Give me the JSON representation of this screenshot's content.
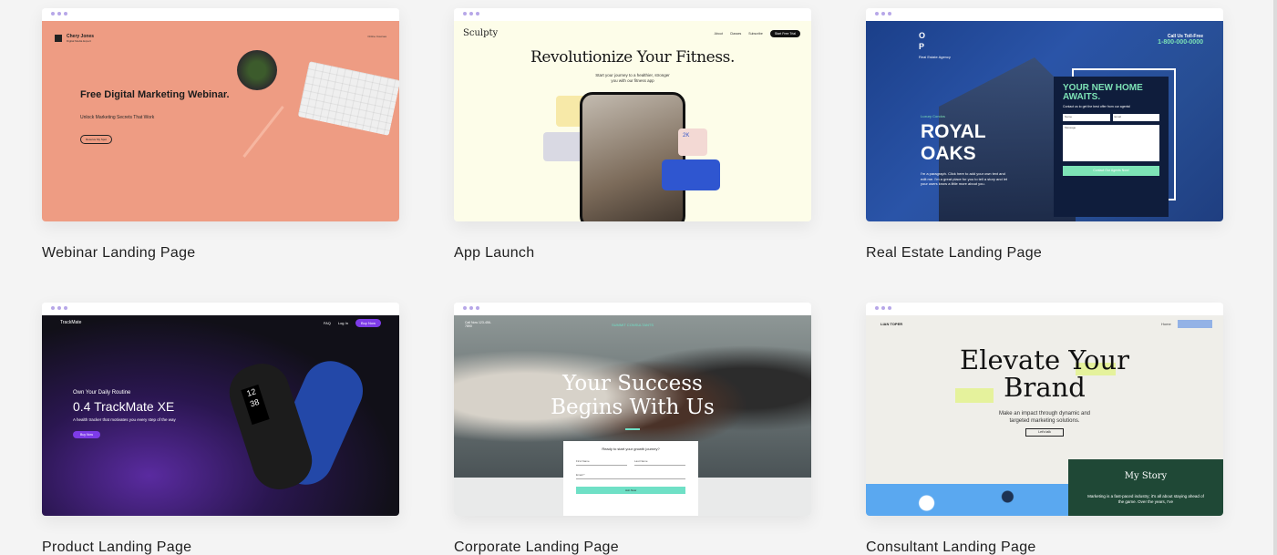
{
  "cards": [
    {
      "caption": "Webinar Landing Page",
      "preview": {
        "brand_name": "Chery Jones",
        "brand_tag": "Digital Media Expert",
        "nav": "Online Courses",
        "title": "Free Digital Marketing Webinar.",
        "subtitle": "Unlock Marketing Secrets That Work",
        "button": "Reserve My Spot"
      }
    },
    {
      "caption": "App Launch",
      "preview": {
        "logo": "Sculpty",
        "nav_1": "About",
        "nav_2": "Classes",
        "nav_3": "Subscribe",
        "nav_button": "Start Free Trial",
        "title": "Revolutionize Your Fitness.",
        "subtitle": "Start your journey to a healthier, stronger you with our fitness app",
        "stat": "2K"
      }
    },
    {
      "caption": "Real Estate Landing Page",
      "preview": {
        "logo": "O P",
        "agency": "Real Estate Agency",
        "call_label": "Call Us Toll-Free",
        "phone": "1-800-000-0000",
        "kicker": "Luxury Condos",
        "title": "ROYAL OAKS",
        "paragraph": "I'm a paragraph. Click here to add your own text and edit me. I'm a great place for you to tell a story and let your users know a little more about you.",
        "form_title": "YOUR NEW HOME AWAITS.",
        "form_text": "Contact us to get the best offer from our agents!",
        "field_name": "Name",
        "field_email": "Email",
        "field_message": "Message",
        "form_button": "Contact Our Agents Now!"
      }
    },
    {
      "caption": "Product Landing Page",
      "preview": {
        "logo": "TrackMate",
        "nav_1": "FAQ",
        "nav_2": "Log In",
        "nav_button": "Buy Now",
        "kicker": "Own Your Daily Routine",
        "title": "0.4 TrackMate XE",
        "subtitle": "A health tracker that motivates you every step of the way",
        "button": "Buy Now",
        "screen_time": "12 38"
      }
    },
    {
      "caption": "Corporate Landing Page",
      "preview": {
        "top_left": "Call Now 123-456-7890",
        "logo": "SUMMIT CONSULTANTS",
        "title": "Your Success Begins With Us",
        "form_prompt": "Ready to start your growth journey?",
        "field_first": "First Name",
        "field_last": "Last Name",
        "field_email": "Email *",
        "form_button": "Join Now"
      }
    },
    {
      "caption": "Consultant Landing Page",
      "preview": {
        "logo": "LIAN TOPER",
        "nav": "Home",
        "title": "Elevate Your Brand",
        "subtitle": "Make an impact through dynamic and targeted marketing solutions.",
        "button": "Let's talk",
        "story_title": "My Story",
        "story_text": "Marketing is a fast-paced industry; it's all about staying ahead of the game. Over the years, I've"
      }
    }
  ]
}
